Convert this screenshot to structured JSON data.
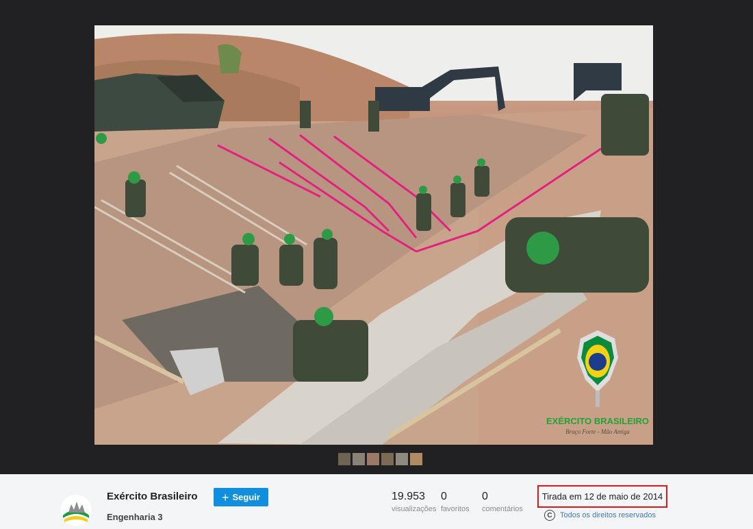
{
  "owner": {
    "name": "Exército Brasileiro",
    "album": "Engenharia 3"
  },
  "follow": {
    "label": "Seguir",
    "icon": "plus-icon"
  },
  "stats": [
    {
      "value": "19.953",
      "label": "visualizações"
    },
    {
      "value": "0",
      "label": "favoritos"
    },
    {
      "value": "0",
      "label": "comentários"
    }
  ],
  "taken": "Tirada em 12 de maio de 2014",
  "rights": {
    "icon": "copyright-icon",
    "label": "Todos os direitos reservados"
  },
  "watermark": {
    "title": "EXÉRCITO BRASILEIRO",
    "subtitle": "Braço Forte - Mão Amiga"
  },
  "thumbnails": [
    "#6d6552",
    "#8a8275",
    "#9a7a66",
    "#7c6a55",
    "#8e8a80",
    "#b08a62"
  ],
  "colors": {
    "accent": "#128fdc",
    "highlight": "#e3141a",
    "link": "#3e7ab8"
  }
}
